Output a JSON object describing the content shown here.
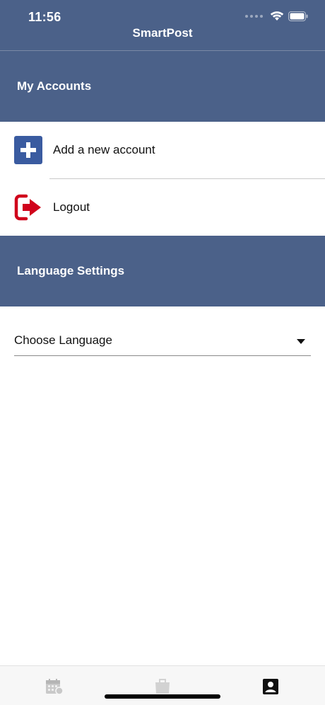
{
  "status_bar": {
    "time": "11:56",
    "signal_icon": "cellular-dots-icon",
    "wifi_icon": "wifi-icon",
    "battery_icon": "battery-icon"
  },
  "app": {
    "title": "SmartPost"
  },
  "accounts": {
    "header": "My Accounts",
    "items": [
      {
        "label": "Add a new account",
        "icon": "plus-square-icon",
        "color": "#3a5ba0"
      },
      {
        "label": "Logout",
        "icon": "logout-icon",
        "color": "#d0021b"
      }
    ]
  },
  "language": {
    "header": "Language Settings",
    "select_placeholder": "Choose Language"
  },
  "tabbar": {
    "tabs": [
      {
        "icon": "calendar-icon",
        "active": false
      },
      {
        "icon": "shop-icon",
        "active": false
      },
      {
        "icon": "account-icon",
        "active": true
      }
    ]
  },
  "colors": {
    "header_bg": "#4b6189",
    "accent_blue": "#3a5ba0",
    "logout_red": "#d0021b"
  }
}
